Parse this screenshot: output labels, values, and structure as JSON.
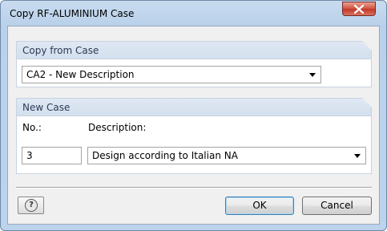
{
  "window": {
    "title": "Copy RF-ALUMINIUM Case",
    "close_icon": "close-icon"
  },
  "copy_from": {
    "heading": "Copy from Case",
    "selected": "CA2 - New Description"
  },
  "new_case": {
    "heading": "New Case",
    "no_label": "No.:",
    "no_value": "3",
    "description_label": "Description:",
    "description_value": "Design according to Italian NA"
  },
  "footer": {
    "help_icon": "help-icon",
    "help_glyph": "?",
    "ok_label": "OK",
    "cancel_label": "Cancel"
  }
}
